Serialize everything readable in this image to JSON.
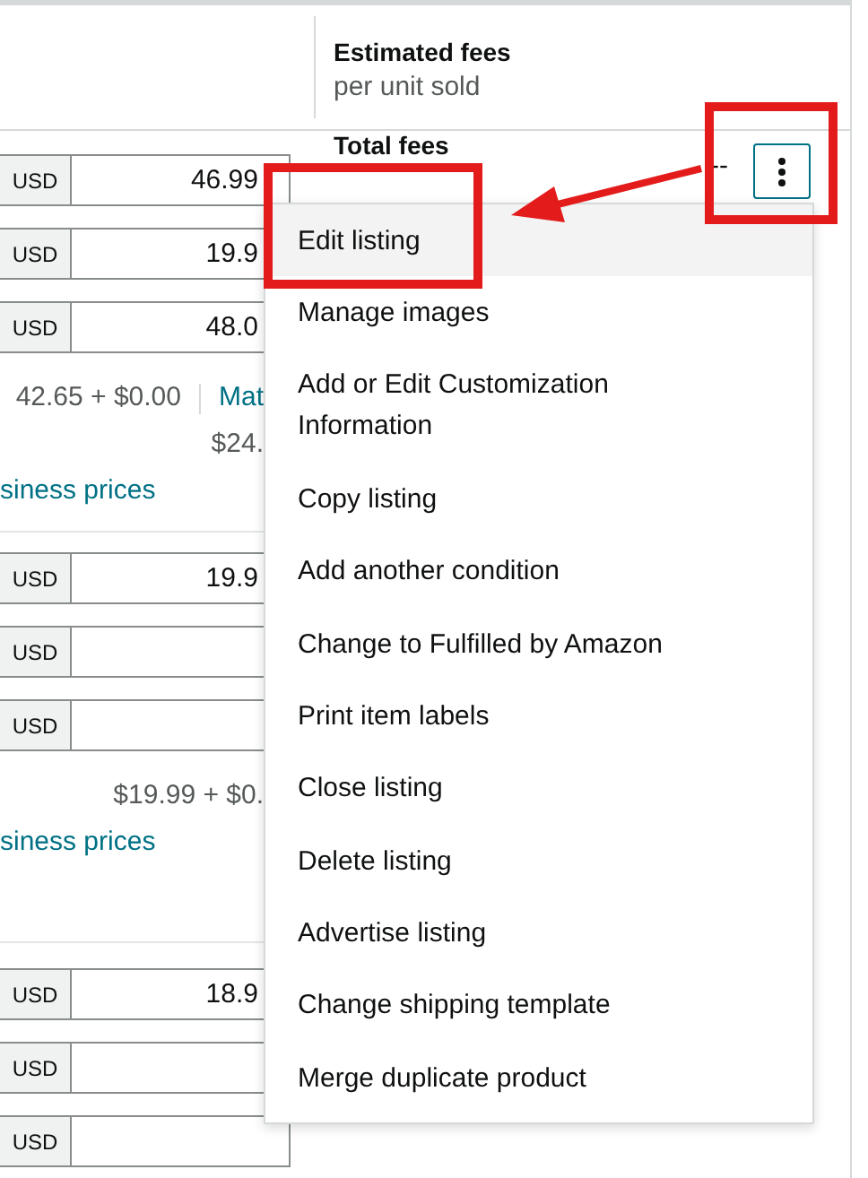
{
  "header": {
    "title": "Estimated fees",
    "subtitle": "per unit sold"
  },
  "fees": {
    "label": "Total fees",
    "value": "--"
  },
  "groups": [
    {
      "prices": [
        {
          "currency": "USD",
          "value": "46.99"
        },
        {
          "currency": "USD",
          "value": "19.9"
        },
        {
          "currency": "USD",
          "value": "48.0"
        }
      ],
      "summary": "42.65 + $0.00",
      "link": "Mat",
      "subvalue": "$24.",
      "business_link": "siness prices"
    },
    {
      "prices": [
        {
          "currency": "USD",
          "value": "19.9"
        },
        {
          "currency": "USD"
        },
        {
          "currency": "USD"
        }
      ],
      "summary": "$19.99 + $0.",
      "business_link": "siness prices"
    },
    {
      "prices": [
        {
          "currency": "USD",
          "value": "18.9"
        },
        {
          "currency": "USD"
        },
        {
          "currency": "USD"
        }
      ]
    }
  ],
  "menu": {
    "items": [
      {
        "label": "Edit listing",
        "selected": true
      },
      {
        "label": "Manage images",
        "selected": false
      },
      {
        "label": "Add or Edit Customization Information",
        "selected": false
      },
      {
        "label": "Copy listing",
        "selected": false
      },
      {
        "label": "Add another condition",
        "selected": false
      },
      {
        "label": "Change to Fulfilled by Amazon",
        "selected": false
      },
      {
        "label": "Print item labels",
        "selected": false
      },
      {
        "label": "Close listing",
        "selected": false
      },
      {
        "label": "Delete listing",
        "selected": false
      },
      {
        "label": "Advertise listing",
        "selected": false
      },
      {
        "label": "Change shipping template",
        "selected": false
      },
      {
        "label": "Merge duplicate product",
        "selected": false
      }
    ]
  }
}
